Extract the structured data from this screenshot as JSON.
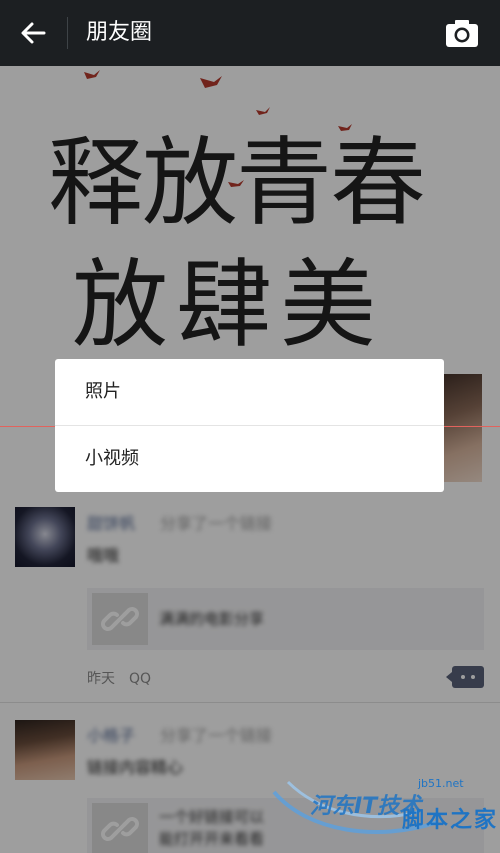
{
  "header": {
    "title": "朋友圈",
    "back_icon": "back-arrow-icon",
    "camera_icon": "camera-icon",
    "bg_color": "#1c1f22"
  },
  "cover": {
    "line1": "释放青春",
    "line2": "放肆美"
  },
  "dialog": {
    "options": [
      "照片",
      "小视频"
    ]
  },
  "feed": {
    "posts": [
      {
        "name": "甜饼帆",
        "action": "分享了一个链接",
        "text": "哦哦",
        "link_title": "满满的电影分享",
        "meta_time": "昨天",
        "meta_source": "QQ"
      },
      {
        "name": "小格子",
        "action": "分享了一个链接",
        "text": "链接内容精心",
        "link_title": "一个好链接可以",
        "link_title_2": "能打开开来看看"
      }
    ]
  },
  "watermark": {
    "url": "jb51.net",
    "text": "脚本之家",
    "mid": "河东IT技术"
  },
  "colors": {
    "accent_red": "#e2635d",
    "link_blue": "#576b95"
  }
}
